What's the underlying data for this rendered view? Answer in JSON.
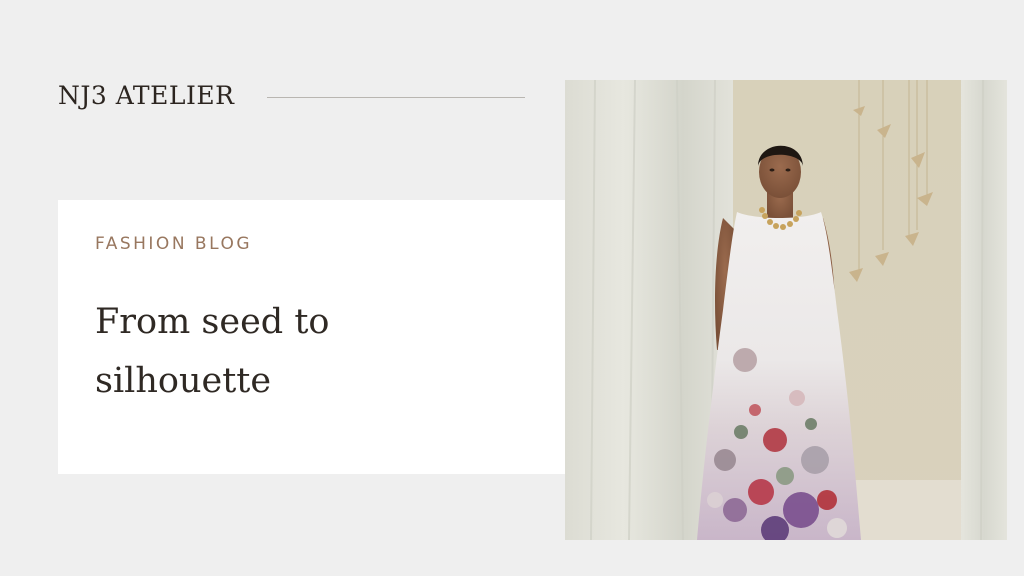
{
  "header": {
    "brand": "NJ3 ATELIER"
  },
  "hero_card": {
    "kicker": "FASHION BLOG",
    "title": "From seed to silhouette"
  },
  "photo": {
    "description_icon": "fashion-photo"
  },
  "colors": {
    "background": "#efefef",
    "card": "#ffffff",
    "kicker": "#98775f",
    "text": "#2f2924"
  }
}
